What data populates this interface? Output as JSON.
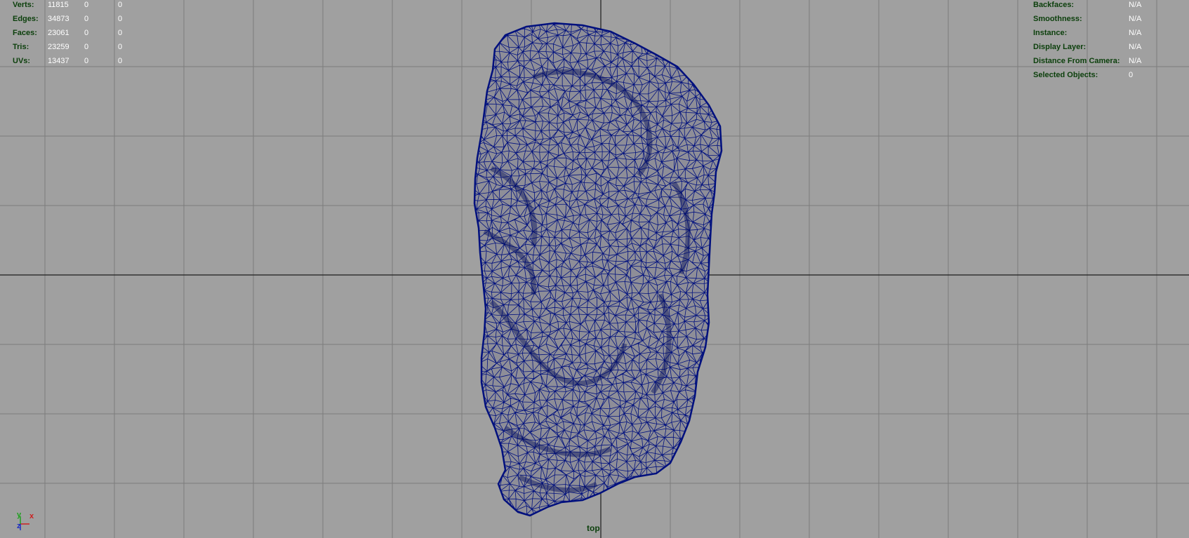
{
  "camera": "top",
  "hud_left": {
    "rows": [
      {
        "label": "Verts:",
        "values": [
          "11815",
          "0",
          "0"
        ]
      },
      {
        "label": "Edges:",
        "values": [
          "34873",
          "0",
          "0"
        ]
      },
      {
        "label": "Faces:",
        "values": [
          "23061",
          "0",
          "0"
        ]
      },
      {
        "label": "Tris:",
        "values": [
          "23259",
          "0",
          "0"
        ]
      },
      {
        "label": "UVs:",
        "values": [
          "13437",
          "0",
          "0"
        ]
      }
    ]
  },
  "hud_right": {
    "rows": [
      {
        "label": "Backfaces:",
        "value": "N/A"
      },
      {
        "label": "Smoothness:",
        "value": "N/A"
      },
      {
        "label": "Instance:",
        "value": "N/A"
      },
      {
        "label": "Display Layer:",
        "value": "N/A"
      },
      {
        "label": "Distance From Camera:",
        "value": "N/A"
      },
      {
        "label": "Selected Objects:",
        "value": "0"
      }
    ]
  },
  "gizmo": {
    "x_label": "x",
    "y_label": "y",
    "z_label": "z"
  },
  "colors": {
    "background": "#a0a0a0",
    "grid": "#7c7c7c",
    "axis": "#1c1c1c",
    "wireframe": "#00107e",
    "hud_label": "#0b3f0b"
  }
}
